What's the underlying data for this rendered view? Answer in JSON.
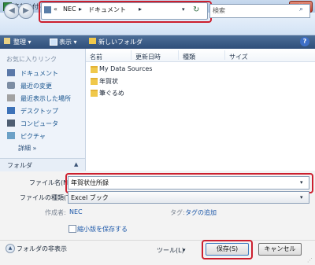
{
  "window": {
    "title": "名前を付けて保存",
    "close_label": "×"
  },
  "nav": {
    "back_glyph": "◀",
    "forward_glyph": "▶",
    "breadcrumb": {
      "lead": "«",
      "segment1": "NEC",
      "sep": "▸",
      "segment2": "ドキュメント",
      "dropdown": "▾"
    },
    "refresh_glyph": "↻",
    "search_placeholder": "検索",
    "search_glyph": "⌕"
  },
  "toolbar": {
    "organize": "整理 ▾",
    "view": "表示 ▾",
    "new_folder": "新しいフォルダ",
    "help": "?"
  },
  "favorites": {
    "header": "お気に入りリンク",
    "items": [
      "ドキュメント",
      "最近の変更",
      "最近表示した場所",
      "デスクトップ",
      "コンピュータ",
      "ピクチャ"
    ],
    "details": "詳細  »"
  },
  "folders_bar": {
    "label": "フォルダ",
    "chevron": "▲"
  },
  "columns": [
    "名前",
    "更新日時",
    "種類",
    "サイズ"
  ],
  "files": [
    "My Data Sources",
    "年賀状",
    "筆ぐるめ"
  ],
  "form": {
    "filename_label": "ファイル名(N):",
    "filename_value": "年賀状住所録",
    "filetype_label": "ファイルの種類(T):",
    "filetype_value": "Excel ブック",
    "author_label": "作成者:",
    "author_value": "NEC",
    "tag_label": "タグ:",
    "tag_value": "タグの追加",
    "thumbnail_label": "縮小版を保存する"
  },
  "bottom": {
    "hide_folders": "フォルダの非表示",
    "tools": "ツール(L)",
    "save": "保存(S)",
    "cancel": "キャンセル"
  },
  "colors": {
    "highlight": "#cc1f2e",
    "toolbar": "#3d5f8c",
    "link": "#1a56a8"
  }
}
